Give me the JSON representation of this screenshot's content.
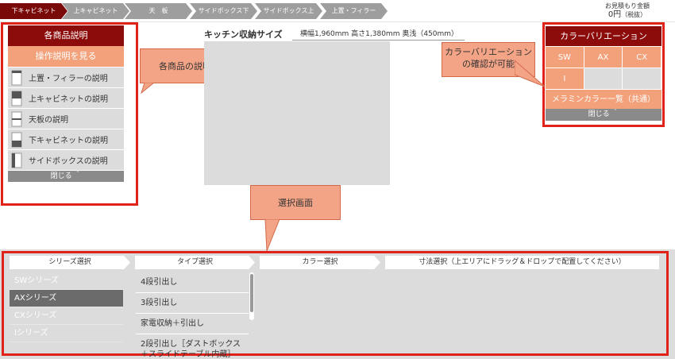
{
  "steps": [
    "下キャビネット",
    "上キャビネット",
    "天　板",
    "サイドボックス下",
    "サイドボックス上",
    "上置・フィラー"
  ],
  "estimate": {
    "label": "お見積もり金額",
    "price": "0円",
    "tax": "（税抜）"
  },
  "left_panel": {
    "title": "各商品説明",
    "howto": "操作説明を見る",
    "items": [
      "上置・フィラーの説明",
      "上キャビネットの説明",
      "天板の説明",
      "下キャビネットの説明",
      "サイドボックスの説明"
    ],
    "close": "閉じる ＾"
  },
  "callouts": {
    "left": "各商品の説明",
    "right": "カラーバリエーションの確認が可能",
    "bottom": "選択画面"
  },
  "kitchen": {
    "title": "キッチン収納サイズ",
    "dim": "横幅1,960mm  高さ1,380mm  奥浅（450mm）"
  },
  "right_panel": {
    "title": "カラーバリエーション",
    "colors": [
      "SW",
      "AX",
      "CX",
      "I"
    ],
    "common": "メラミンカラー一覧（共通）",
    "close": "閉じる ＾"
  },
  "bottom": {
    "tabs": [
      "シリーズ選択",
      "タイプ選択",
      "カラー選択",
      "寸法選択（上エリアにドラッグ＆ドロップで配置してください）"
    ],
    "series": [
      "SWシリーズ",
      "AXシリーズ",
      "CXシリーズ",
      "Iシリーズ"
    ],
    "types": [
      "4段引出し",
      "3段引出し",
      "家電収納＋引出し",
      "2段引出し［ダストボックス＋スライドテーブル内蔵］"
    ]
  },
  "colors": {
    "dark_red": "#8c0b0b",
    "salmon": "#f2a17b",
    "highlight_red": "#e0221b",
    "gray": "#dcdcdc"
  }
}
